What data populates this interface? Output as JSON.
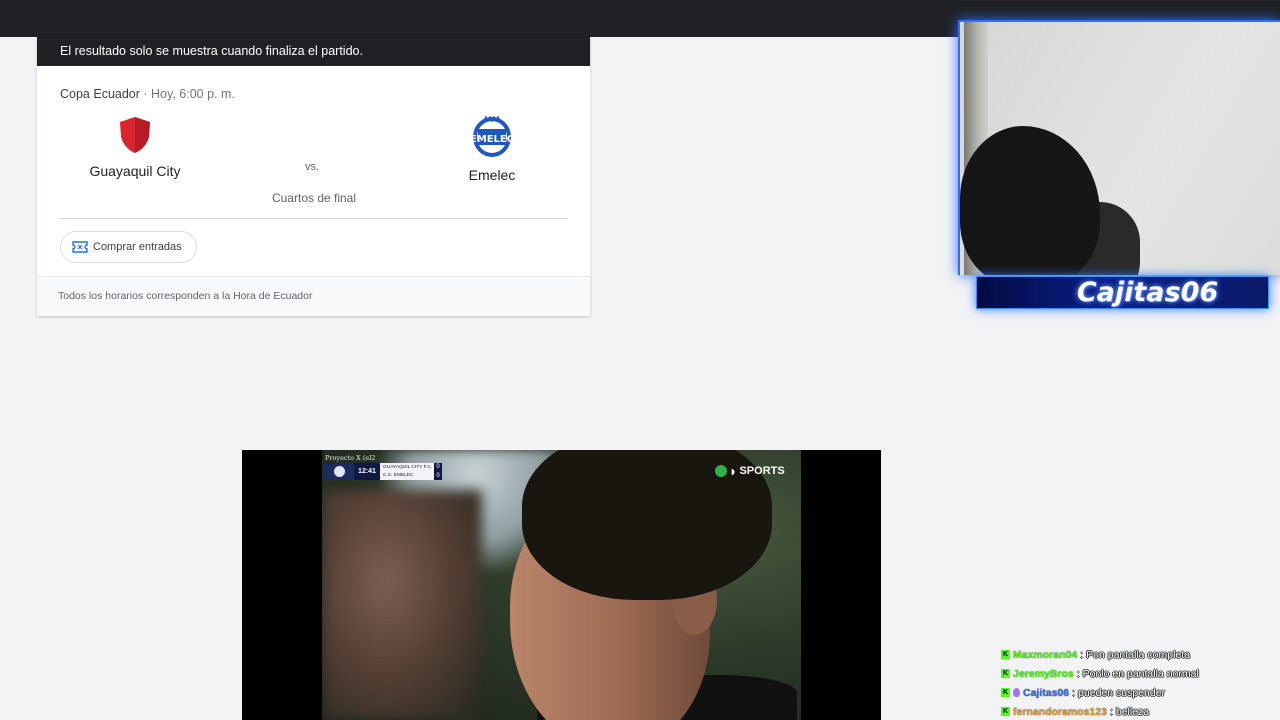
{
  "match_card": {
    "notice": "El resultado solo se muestra cuando finaliza el partido.",
    "competition": "Copa Ecuador",
    "separator": " · ",
    "datetime": "Hoy, 6:00 p. m.",
    "home_team": "Guayaquil City",
    "away_team": "Emelec",
    "vs": "vs.",
    "stage": "Cuartos de final",
    "buy_tickets_label": "Comprar entradas",
    "footer_note": "Todos los horarios corresponden a la Hora de Ecuador"
  },
  "stream_overlay": {
    "streamer_name": "Cajitas06",
    "accent_color": "#2f6fff"
  },
  "video": {
    "overlay_tag": "Proyecto X (el2",
    "clock": "12:41",
    "team_home": "GUAYAQUIL CITY F.C.",
    "team_away": "C.S. EMELEC",
    "score_home": "0",
    "score_away": "0",
    "broadcaster": "SPORTS"
  },
  "chat": [
    {
      "user": "Maxmoran04",
      "color": "#53fc18",
      "message": "Pon pantalla completa",
      "badges": [
        "kick-badge"
      ]
    },
    {
      "user": "JeremyBros",
      "color": "#53fc18",
      "message": "Ponlo en pantalla normal",
      "badges": [
        "kick-badge"
      ]
    },
    {
      "user": "Cajitas06",
      "color": "#2f6fff",
      "message": "pueden suspender",
      "badges": [
        "kick-badge",
        "broadcaster-badge"
      ]
    },
    {
      "user": "fernandoramos123",
      "color": "#e0a040",
      "message": "belleza",
      "badges": [
        "kick-badge"
      ]
    }
  ]
}
